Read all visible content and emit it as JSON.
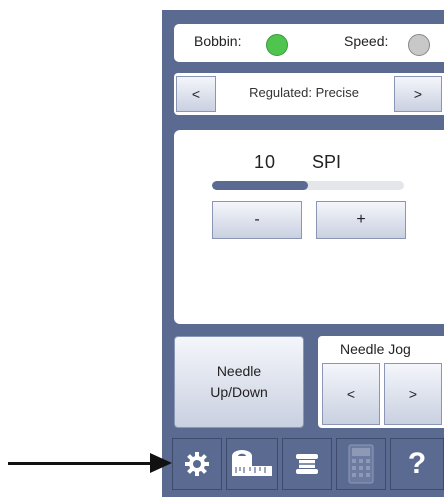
{
  "status": {
    "bobbin_label": "Bobbin:",
    "speed_label": "Speed:",
    "bobbin_color": "#4fc44f",
    "speed_color": "#c8c8c8"
  },
  "mode": {
    "prev_label": "<",
    "next_label": ">",
    "current": "Regulated: Precise"
  },
  "spi": {
    "value": "10",
    "unit": "SPI",
    "level_fraction": 0.5,
    "minus_label": "-",
    "plus_label": "+"
  },
  "needle": {
    "button_line1": "Needle",
    "button_line2": "Up/Down",
    "jog_title": "Needle Jog",
    "jog_left": "<",
    "jog_right": ">"
  },
  "toolbar": {
    "icons": [
      "gear-icon",
      "tape-measure-icon",
      "bobbin-icon",
      "calculator-icon",
      "help-icon"
    ],
    "help_label": "?"
  },
  "colors": {
    "panel": "#5b6a91",
    "button_light": "#f4f6fb",
    "button_dark": "#c9d0e0"
  }
}
